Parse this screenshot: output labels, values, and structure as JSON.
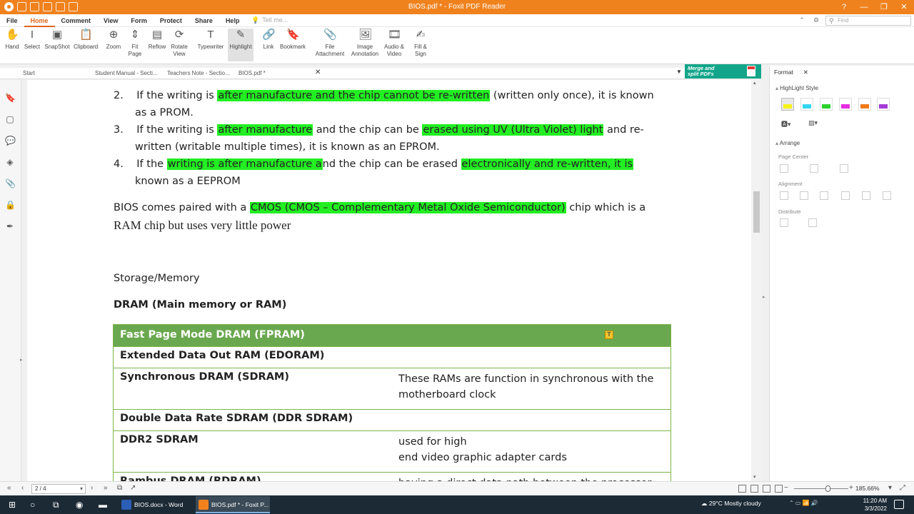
{
  "titlebar": {
    "title": "BIOS.pdf * - Foxit PDF Reader",
    "controls": [
      "?",
      "—",
      "❐",
      "✕"
    ]
  },
  "menubar": {
    "items": [
      "File",
      "Home",
      "Comment",
      "View",
      "Form",
      "Protect",
      "Share",
      "Help"
    ],
    "active": "Home",
    "tell_me": "Tell me...",
    "find_placeholder": "Find"
  },
  "ribbon": {
    "tools": [
      {
        "label": "Hand",
        "icon": "hand-icon"
      },
      {
        "label": "Select",
        "icon": "select-icon"
      },
      {
        "label": "SnapShot",
        "icon": "snapshot-icon"
      },
      {
        "label": "Clipboard",
        "icon": "clipboard-icon"
      },
      {
        "label": "Zoom",
        "icon": "zoom-icon"
      },
      {
        "label": "Fit Page",
        "icon": "fit-page-icon"
      },
      {
        "label": "Reflow",
        "icon": "reflow-icon"
      },
      {
        "label": "Rotate View",
        "icon": "rotate-icon"
      },
      {
        "label": "Typewriter",
        "icon": "typewriter-icon"
      },
      {
        "label": "Highlight",
        "icon": "highlight-icon"
      },
      {
        "label": "Link",
        "icon": "link-icon"
      },
      {
        "label": "Bookmark",
        "icon": "bookmark-icon"
      },
      {
        "label": "File Attachment",
        "icon": "attachment-icon"
      },
      {
        "label": "Image Annotation",
        "icon": "image-icon"
      },
      {
        "label": "Audio & Video",
        "icon": "audio-video-icon"
      },
      {
        "label": "Fill & Sign",
        "icon": "fill-sign-icon"
      }
    ]
  },
  "tabs": {
    "items": [
      "Start",
      "Student Manual - Secti...",
      "Teachers Note - Sectio...",
      "BIOS.pdf *"
    ],
    "active": "BIOS.pdf *"
  },
  "promo": {
    "line1": "Merge and",
    "line2": "split PDFs"
  },
  "document": {
    "items": [
      {
        "num": "2.",
        "l1a": "If the writing is ",
        "l1h": "after manufacture and the chip cannot be re-written",
        "l1b": " (written only once), it is known",
        "l2": "as a PROM."
      },
      {
        "num": "3.",
        "l1a": "If the writing is ",
        "l1h": "after manufacture",
        "l1b": " and the chip can be ",
        "l1h2": "erased using UV (Ultra Violet) light",
        "l1c": " and re-",
        "l2": "written (writable multiple times), it is known as an EPROM."
      },
      {
        "num": "4.",
        "l1a": "If the ",
        "l1h": "writing is after manufacture a",
        "l1b": "nd the chip can be erased ",
        "l1h2": "electronically and re-written, it is",
        "l2": "known as a EEPROM"
      }
    ],
    "bios_a": "BIOS comes paired with a ",
    "bios_h": "CMOS (CMOS – Complementary Metal Oxide Semiconductor)",
    "bios_b": " chip which is a",
    "bios_l2": "RAM chip but uses very little power",
    "storage": "Storage/Memory",
    "dram": "DRAM (Main memory or RAM)",
    "table": {
      "header": "Fast Page Mode DRAM (FPRAM)",
      "rows": [
        {
          "name": "Extended Data Out RAM (EDORAM)",
          "desc1": "",
          "desc2": ""
        },
        {
          "name": "Synchronous DRAM (SDRAM)",
          "desc1": "These RAMs are function in synchronous with the",
          "desc2": "motherboard clock"
        },
        {
          "name": "Double Data Rate SDRAM (DDR SDRAM)",
          "desc1": "",
          "desc2": ""
        },
        {
          "name": "DDR2 SDRAM",
          "desc1": "used for high",
          "desc2": "end video graphic adapter cards"
        },
        {
          "name": "Rambus DRAM (RDRAM)",
          "desc1": "having a direct data path between the processor",
          "desc2": ""
        }
      ]
    }
  },
  "format_panel": {
    "tab": "Format",
    "highlight_style": "HighLight Style",
    "swatch_colors": [
      "#f7f31a",
      "#35d6f0",
      "#2ed02e",
      "#e52ee0",
      "#f07a1a",
      "#a63bd6"
    ],
    "arrange": "Arrange",
    "page_center": "Page Center",
    "alignment": "Alignment",
    "distribute": "Distribute"
  },
  "statusbar": {
    "page": "2 / 4",
    "zoom": "185.66%"
  },
  "taskbar": {
    "tasks": [
      {
        "label": "BIOS.docx - Word",
        "color": "#2b5eb6"
      },
      {
        "label": "BIOS.pdf * - Foxit P...",
        "color": "#f0821e"
      }
    ],
    "weather": "29°C  Mostly cloudy",
    "time": "11:20 AM",
    "date": "3/3/2022"
  },
  "colors": {
    "accent": "#f0821e",
    "highlight": "#22ee22",
    "table_header": "#6aa84f",
    "table_border": "#7ab648"
  }
}
